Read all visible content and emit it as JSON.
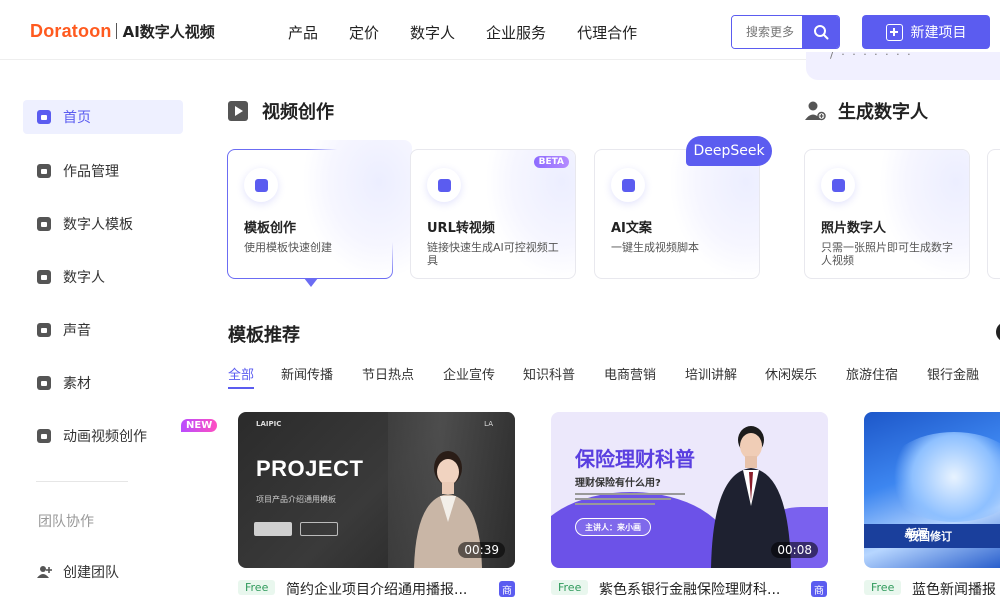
{
  "header": {
    "logo_brand": "Doratoon",
    "logo_sub": "AI数字人视频",
    "nav": [
      "产品",
      "定价",
      "数字人",
      "企业服务",
      "代理合作"
    ],
    "search_placeholder": "搜索更多",
    "new_project_label": "新建项目",
    "dropdown_peek_text": "/ · · · ·  · · ·"
  },
  "sidebar": {
    "items": [
      {
        "label": "首页",
        "icon": "home-icon"
      },
      {
        "label": "作品管理",
        "icon": "folder-icon"
      },
      {
        "label": "数字人模板",
        "icon": "puzzle-icon"
      },
      {
        "label": "数字人",
        "icon": "person-icon"
      },
      {
        "label": "声音",
        "icon": "sound-icon"
      },
      {
        "label": "素材",
        "icon": "cloud-icon"
      },
      {
        "label": "动画视频创作",
        "icon": "sparkle-icon",
        "badge": "NEW"
      }
    ],
    "group_label": "团队协作",
    "create_team_label": "创建团队"
  },
  "sections": {
    "video_creation": "视频创作",
    "digital_human": "生成数字人",
    "template_recommend": "模板推荐"
  },
  "feature_cards": [
    {
      "title": "模板创作",
      "desc": "使用模板快速创建",
      "icon": "puzzle-icon"
    },
    {
      "title": "URL转视频",
      "desc": "链接快速生成AI可控视频工具",
      "icon": "link-icon",
      "badge": "BETA"
    },
    {
      "title": "AI文案",
      "desc": "一键生成视频脚本",
      "icon": "ai-icon"
    },
    {
      "title": "照片数字人",
      "desc": "只需一张照片即可生成数字人视频",
      "icon": "photo-person-icon"
    }
  ],
  "deepseek_label": "DeepSeek",
  "tabs": [
    "全部",
    "新闻传播",
    "节日热点",
    "企业宣传",
    "知识科普",
    "电商营销",
    "培训讲解",
    "休闲娱乐",
    "旅游住宿",
    "银行金融"
  ],
  "templates": [
    {
      "title": "简约企业项目介绍通用播报...",
      "duration": "00:39",
      "free": "Free",
      "commercial": "商",
      "thumb_brand": "LAIPIC",
      "thumb_heading": "PROJECT",
      "thumb_sub": "项目产品介绍通用模板",
      "thumb_corner": "LA"
    },
    {
      "title": "紫色系银行金融保险理财科...",
      "duration": "00:08",
      "free": "Free",
      "commercial": "商",
      "thumb_heading": "保险理财科普",
      "thumb_sub": "理财保险有什么用?",
      "thumb_host": "主讲人：来小画"
    },
    {
      "title": "蓝色新闻播报",
      "free": "Free",
      "thumb_news": "新闻",
      "thumb_news2": "我国修订"
    }
  ],
  "colors": {
    "accent": "#5b5cf0",
    "brand": "#ff5a1f",
    "free_green": "#2f9a5b"
  }
}
